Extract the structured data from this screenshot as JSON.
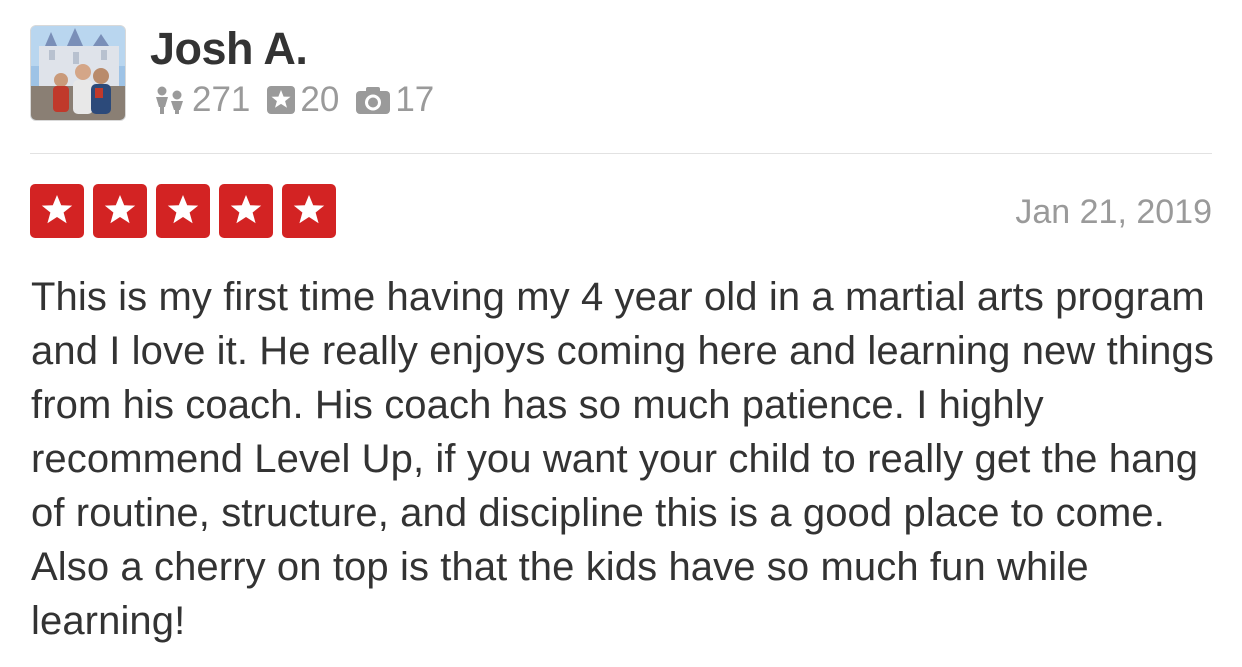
{
  "user": {
    "name": "Josh A.",
    "friends_count": "271",
    "reviews_count": "20",
    "photos_count": "17",
    "avatar_icon": "user-photo-avatar",
    "stat_icons": [
      "friends-icon",
      "star-review-icon",
      "camera-icon"
    ]
  },
  "review": {
    "rating": 5,
    "rating_max": 5,
    "star_color": "#d32323",
    "date": "Jan 21, 2019",
    "text": "This is my first time having my 4 year old in a martial arts program and I love it. He really enjoys coming here and learning new things from his coach. His coach has so much patience. I highly recommend Level Up, if you want your child to really get the hang of routine, structure, and discipline this is a good place to come. Also a cherry on top is that the kids have so much fun while learning!"
  }
}
